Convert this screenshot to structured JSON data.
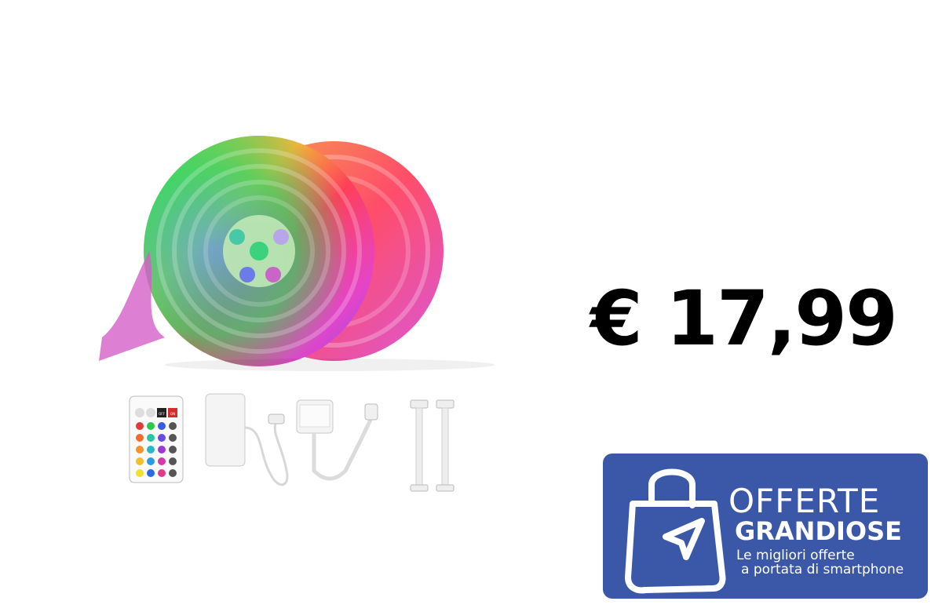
{
  "product": {
    "price": "€ 17,99"
  },
  "badge": {
    "line1": "OFFERTE",
    "line2": "GRANDIOSE",
    "tagline1": "Le migliori offerte",
    "tagline2": "a portata di smartphone",
    "background_color": "#3b57a8"
  },
  "remote": {
    "off_label": "OFF",
    "on_label": "ON"
  },
  "icons": [
    "shopping-bag-icon",
    "cursor-arrow-icon"
  ]
}
